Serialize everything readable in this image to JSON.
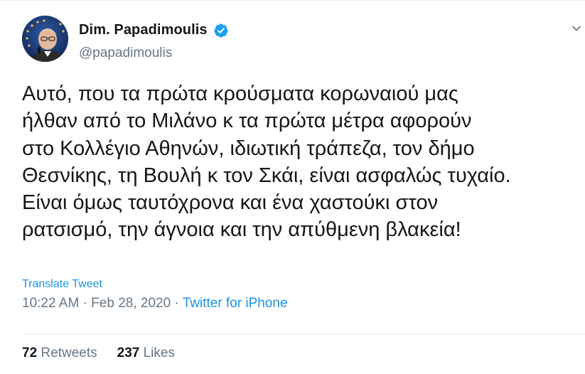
{
  "user": {
    "display_name": "Dim. Papadimoulis",
    "handle": "@papadimoulis",
    "verified": true,
    "avatar": "profile-photo"
  },
  "menu_icon": "chevron-down-icon",
  "tweet": {
    "text": "Αυτό, που τα πρώτα κρούσματα κορωναιού μας\nήλθαν από το Μιλάνο κ τα πρώτα μέτρα αφορούν\nστο Κολλέγιο Αθηνών, ιδιωτική τράπεζα, τον δήμο\nΘεσνίκης, τη Βουλή κ τον Σκάι, είναι ασφαλώς τυχαίο.\nΕίναι όμως ταυτόχρονα και ένα χαστούκι στον\nρατσισμό, την άγνοια και την απύθμενη βλακεία!",
    "translate_label": "Translate Tweet",
    "time": "10:22 AM",
    "separator": "·",
    "date": "Feb 28, 2020",
    "source": "Twitter for iPhone"
  },
  "stats": {
    "retweets_count": "72",
    "retweets_label": "Retweets",
    "likes_count": "237",
    "likes_label": "Likes"
  },
  "colors": {
    "link": "#1b95e0",
    "muted": "#657786",
    "text": "#14171a",
    "verified": "#1da1f2"
  }
}
